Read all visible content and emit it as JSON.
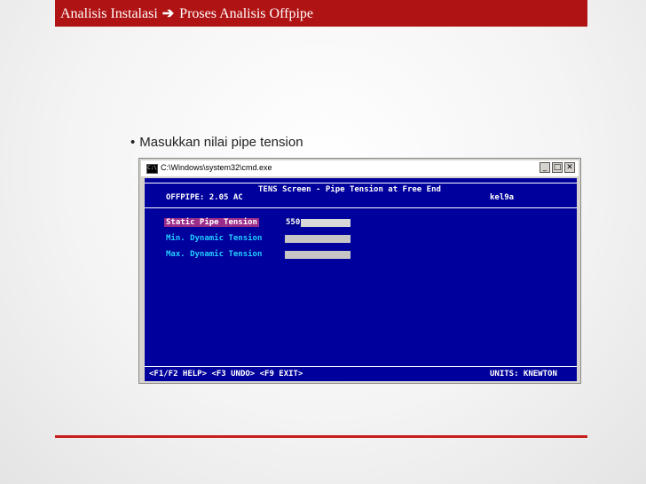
{
  "slide": {
    "title_part1": "Analisis Instalasi",
    "title_arrow": "➔",
    "title_part2": "Proses Analisis Offpipe",
    "bullet_char": "•",
    "bullet_text": "Masukkan nilai pipe tension"
  },
  "window": {
    "title": "C:\\Windows\\system32\\cmd.exe",
    "icon_text": "C:\\",
    "min_label": "_",
    "max_label": "□",
    "close_label": "✕"
  },
  "screen": {
    "header_title": "TENS Screen - Pipe Tension at Free End",
    "header_program": "OFFPIPE: 2.05 AC",
    "header_user": "kel9a",
    "fields": [
      {
        "label": "Static Pipe Tension",
        "value": "550"
      },
      {
        "label": "Min. Dynamic Tension",
        "value": ""
      },
      {
        "label": "Max. Dynamic Tension",
        "value": ""
      }
    ],
    "footer_keys": "<F1/F2 HELP> <F3 UNDO> <F9 EXIT>",
    "footer_units": "UNITS: KNEWTON"
  },
  "colors": {
    "title_bar": "#b01313",
    "accent_line": "#c81d1d",
    "console_bg": "#00009c",
    "field_label": "#22cfff",
    "active_field": "#9a2c8a"
  }
}
